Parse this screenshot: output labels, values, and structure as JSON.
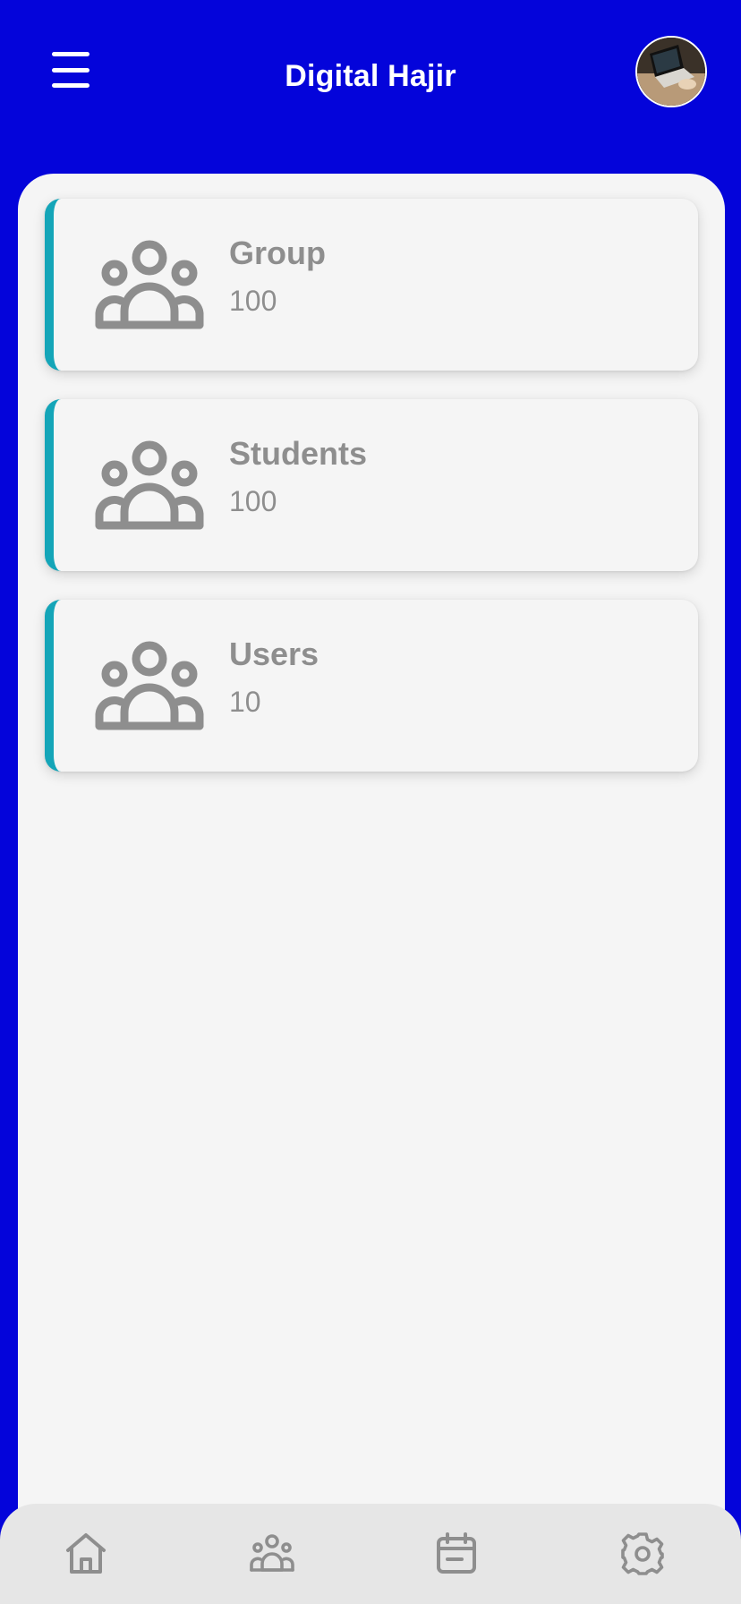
{
  "header": {
    "title": "Digital Hajir",
    "menu_icon": "hamburger-menu-icon",
    "avatar_icon": "profile-avatar"
  },
  "colors": {
    "header_bg": "#0404DA",
    "panel_bg": "#F5F5F5",
    "card_accent": "#14A5B8",
    "text_gray": "#8E8E8E",
    "nav_bg": "#E6E6E6"
  },
  "cards": [
    {
      "label": "Group",
      "count": "100",
      "icon": "people-group-icon"
    },
    {
      "label": "Students",
      "count": "100",
      "icon": "people-group-icon"
    },
    {
      "label": "Users",
      "count": "10",
      "icon": "people-group-icon"
    }
  ],
  "bottom_nav": [
    {
      "icon": "home-icon"
    },
    {
      "icon": "people-group-icon"
    },
    {
      "icon": "calendar-icon"
    },
    {
      "icon": "settings-gear-icon"
    }
  ]
}
